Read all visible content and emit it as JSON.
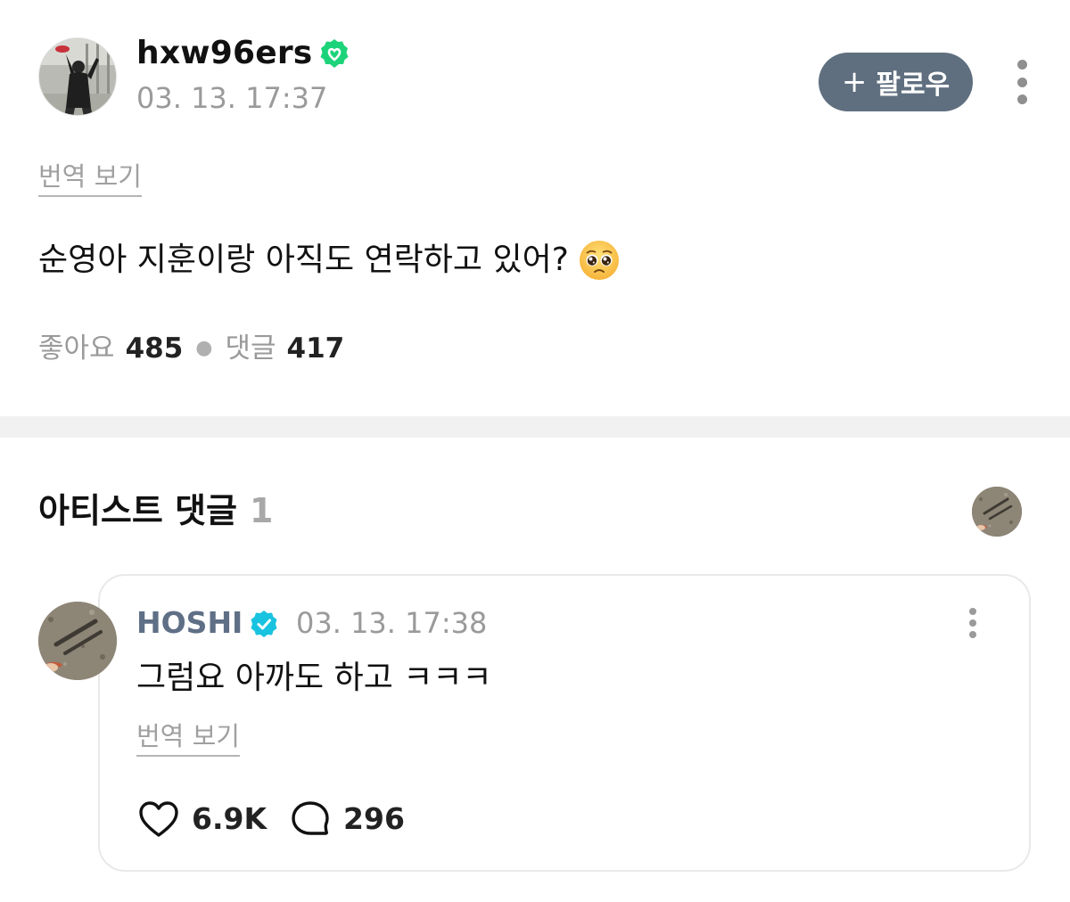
{
  "post": {
    "author": "hxw96ers",
    "timestamp": "03. 13. 17:37",
    "follow_label": "팔로우",
    "translate_label": "번역 보기",
    "text": "순영아 지훈이랑 아직도 연락하고 있어?",
    "emoji": "pleading-face",
    "likes_label": "좋아요",
    "likes_count": "485",
    "comments_label": "댓글",
    "comments_count": "417"
  },
  "artist_comments": {
    "title": "아티스트 댓글",
    "count": "1",
    "comment": {
      "author": "HOSHI",
      "timestamp": "03. 13. 17:38",
      "text": "그럼요 아까도 하고 ㅋㅋㅋ",
      "translate_label": "번역 보기",
      "likes": "6.9K",
      "replies": "296"
    }
  },
  "colors": {
    "follow_button_bg": "#5f6f7f",
    "verified_green": "#1dd37a",
    "verified_blue": "#18c3e0",
    "artist_name": "#5f6f86",
    "divider": "#f1f1f1"
  },
  "icons": [
    "verified-badge-icon",
    "plus-icon",
    "more-options-icon",
    "heart-icon",
    "comment-bubble-icon",
    "pleading-face-emoji"
  ]
}
